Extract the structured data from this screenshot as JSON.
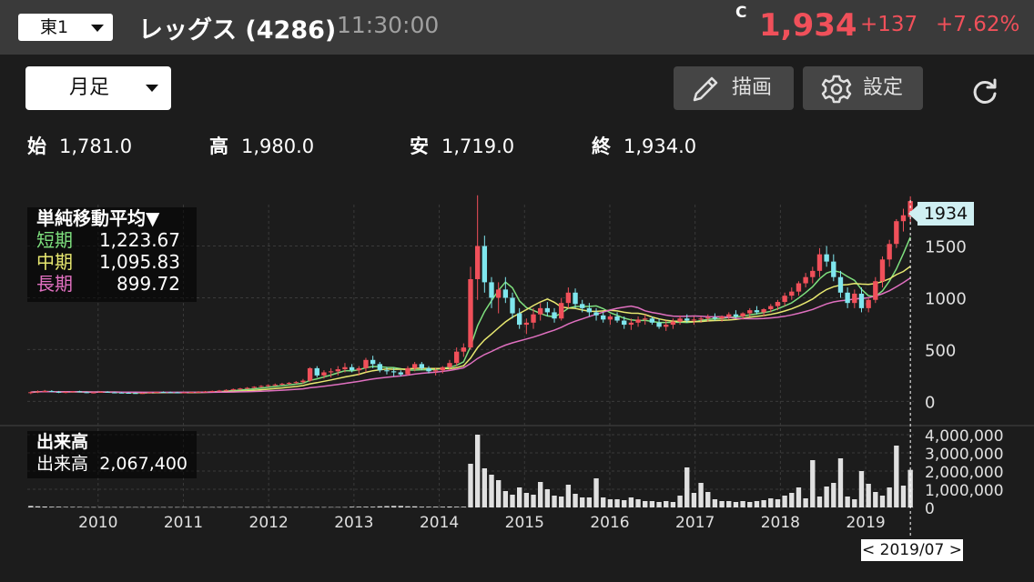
{
  "header": {
    "market": "東1",
    "title": "レッグス (4286)",
    "time": "11:30:00",
    "c_mark": "C",
    "price": "1,934",
    "change": "+137",
    "change_pct": "+7.62%",
    "up_color": "#f0505a"
  },
  "toolbar": {
    "period": "月足",
    "draw_label": "描画",
    "settings_label": "設定"
  },
  "ohlc": {
    "open_label": "始",
    "open": "1,781.0",
    "high_label": "高",
    "high": "1,980.0",
    "low_label": "安",
    "low": "1,719.0",
    "close_label": "終",
    "close": "1,934.0"
  },
  "ma_legend": {
    "title": "単純移動平均▼",
    "short_label": "短期",
    "short": "1,223.67",
    "short_color": "#7ee07e",
    "mid_label": "中期",
    "mid": "1,095.83",
    "mid_color": "#e8e870",
    "long_label": "長期",
    "long": "899.72",
    "long_color": "#e070c0"
  },
  "volume_legend": {
    "title": "出来高",
    "label": "出来高",
    "value": "2,067,400"
  },
  "price_tag": "1934",
  "date_tag": "< 2019/07 >",
  "chart_data": {
    "type": "candlestick",
    "interval": "monthly",
    "price_axis": {
      "ticks": [
        0,
        500,
        1000,
        1500
      ],
      "tick_labels": [
        "0",
        "500",
        "1000",
        "1500"
      ],
      "range": [
        -120,
        1900
      ]
    },
    "volume_axis": {
      "ticks": [
        0,
        1000000,
        2000000,
        3000000,
        4000000
      ],
      "tick_labels": [
        "0",
        "1,000,000",
        "2,000,000",
        "3,000,000",
        "4,000,000"
      ],
      "range": [
        0,
        4000000
      ]
    },
    "x_labels": [
      "2010",
      "2011",
      "2012",
      "2013",
      "2014",
      "2015",
      "2016",
      "2017",
      "2018",
      "2019"
    ],
    "x_start": 2009.17,
    "ohlc": [
      [
        80,
        95,
        70,
        88
      ],
      [
        88,
        105,
        80,
        95
      ],
      [
        95,
        110,
        88,
        100
      ],
      [
        100,
        108,
        88,
        92
      ],
      [
        92,
        100,
        80,
        85
      ],
      [
        85,
        95,
        78,
        90
      ],
      [
        90,
        100,
        85,
        96
      ],
      [
        96,
        102,
        86,
        88
      ],
      [
        88,
        94,
        80,
        82
      ],
      [
        82,
        90,
        76,
        86
      ],
      [
        86,
        95,
        82,
        92
      ],
      [
        92,
        98,
        84,
        86
      ],
      [
        86,
        92,
        80,
        84
      ],
      [
        84,
        90,
        78,
        82
      ],
      [
        82,
        88,
        76,
        80
      ],
      [
        80,
        86,
        74,
        78
      ],
      [
        78,
        84,
        72,
        80
      ],
      [
        80,
        90,
        76,
        86
      ],
      [
        86,
        94,
        80,
        90
      ],
      [
        90,
        96,
        84,
        88
      ],
      [
        88,
        94,
        82,
        86
      ],
      [
        86,
        92,
        80,
        84
      ],
      [
        84,
        90,
        78,
        86
      ],
      [
        86,
        92,
        82,
        90
      ],
      [
        90,
        98,
        84,
        92
      ],
      [
        92,
        100,
        86,
        96
      ],
      [
        96,
        104,
        90,
        100
      ],
      [
        100,
        110,
        94,
        104
      ],
      [
        104,
        116,
        98,
        110
      ],
      [
        110,
        124,
        104,
        118
      ],
      [
        118,
        130,
        110,
        124
      ],
      [
        124,
        138,
        116,
        130
      ],
      [
        130,
        146,
        122,
        140
      ],
      [
        140,
        156,
        132,
        148
      ],
      [
        148,
        164,
        138,
        156
      ],
      [
        156,
        172,
        146,
        162
      ],
      [
        162,
        178,
        154,
        170
      ],
      [
        170,
        186,
        160,
        178
      ],
      [
        178,
        196,
        168,
        186
      ],
      [
        186,
        216,
        170,
        200
      ],
      [
        200,
        330,
        190,
        320
      ],
      [
        320,
        340,
        230,
        250
      ],
      [
        250,
        300,
        220,
        280
      ],
      [
        280,
        320,
        230,
        290
      ],
      [
        290,
        340,
        250,
        310
      ],
      [
        310,
        370,
        280,
        330
      ],
      [
        330,
        360,
        280,
        300
      ],
      [
        300,
        340,
        250,
        320
      ],
      [
        320,
        420,
        280,
        400
      ],
      [
        400,
        440,
        320,
        360
      ],
      [
        360,
        380,
        280,
        300
      ],
      [
        300,
        330,
        260,
        290
      ],
      [
        290,
        320,
        240,
        280
      ],
      [
        280,
        300,
        240,
        260
      ],
      [
        260,
        340,
        250,
        320
      ],
      [
        320,
        380,
        290,
        360
      ],
      [
        360,
        380,
        300,
        320
      ],
      [
        320,
        340,
        270,
        290
      ],
      [
        290,
        320,
        250,
        300
      ],
      [
        300,
        340,
        270,
        330
      ],
      [
        330,
        400,
        300,
        370
      ],
      [
        370,
        520,
        340,
        480
      ],
      [
        480,
        560,
        430,
        520
      ],
      [
        520,
        1300,
        500,
        1180
      ],
      [
        1180,
        1990,
        980,
        1500
      ],
      [
        1500,
        1600,
        1050,
        1150
      ],
      [
        1150,
        1200,
        900,
        1000
      ],
      [
        1000,
        1150,
        850,
        1080
      ],
      [
        1080,
        1200,
        950,
        1000
      ],
      [
        1000,
        1050,
        800,
        850
      ],
      [
        850,
        900,
        700,
        740
      ],
      [
        740,
        800,
        650,
        760
      ],
      [
        760,
        900,
        700,
        840
      ],
      [
        840,
        950,
        780,
        900
      ],
      [
        900,
        960,
        820,
        860
      ],
      [
        860,
        900,
        760,
        800
      ],
      [
        800,
        1000,
        780,
        950
      ],
      [
        950,
        1100,
        900,
        1050
      ],
      [
        1050,
        1090,
        900,
        940
      ],
      [
        940,
        980,
        860,
        900
      ],
      [
        900,
        950,
        820,
        860
      ],
      [
        860,
        900,
        780,
        830
      ],
      [
        830,
        860,
        760,
        790
      ],
      [
        790,
        840,
        740,
        820
      ],
      [
        820,
        860,
        760,
        780
      ],
      [
        780,
        820,
        700,
        740
      ],
      [
        740,
        800,
        690,
        760
      ],
      [
        760,
        820,
        720,
        790
      ],
      [
        790,
        840,
        740,
        800
      ],
      [
        800,
        820,
        740,
        760
      ],
      [
        760,
        800,
        700,
        720
      ],
      [
        720,
        780,
        680,
        740
      ],
      [
        740,
        800,
        700,
        770
      ],
      [
        770,
        830,
        740,
        800
      ],
      [
        800,
        840,
        760,
        780
      ],
      [
        780,
        820,
        740,
        790
      ],
      [
        790,
        820,
        760,
        800
      ],
      [
        800,
        840,
        770,
        810
      ],
      [
        810,
        850,
        780,
        800
      ],
      [
        800,
        830,
        770,
        820
      ],
      [
        820,
        860,
        790,
        840
      ],
      [
        840,
        880,
        800,
        820
      ],
      [
        820,
        860,
        790,
        850
      ],
      [
        850,
        900,
        820,
        880
      ],
      [
        880,
        920,
        840,
        860
      ],
      [
        860,
        900,
        820,
        890
      ],
      [
        890,
        940,
        860,
        920
      ],
      [
        920,
        980,
        880,
        960
      ],
      [
        960,
        1050,
        920,
        1020
      ],
      [
        1020,
        1100,
        980,
        1060
      ],
      [
        1060,
        1160,
        1020,
        1140
      ],
      [
        1140,
        1240,
        1100,
        1200
      ],
      [
        1200,
        1300,
        1140,
        1260
      ],
      [
        1260,
        1480,
        1200,
        1420
      ],
      [
        1420,
        1500,
        1300,
        1350
      ],
      [
        1350,
        1420,
        1160,
        1200
      ],
      [
        1200,
        1260,
        1000,
        1050
      ],
      [
        1050,
        1100,
        900,
        950
      ],
      [
        950,
        1080,
        900,
        1040
      ],
      [
        1040,
        1100,
        860,
        900
      ],
      [
        900,
        1000,
        860,
        980
      ],
      [
        980,
        1200,
        950,
        1160
      ],
      [
        1160,
        1400,
        1100,
        1370
      ],
      [
        1370,
        1560,
        1300,
        1520
      ],
      [
        1520,
        1760,
        1480,
        1740
      ],
      [
        1740,
        1860,
        1640,
        1797
      ],
      [
        1781,
        1980,
        1719,
        1934
      ]
    ],
    "volume": [
      80000,
      60000,
      50000,
      40000,
      40000,
      30000,
      30000,
      30000,
      20000,
      20000,
      20000,
      20000,
      20000,
      20000,
      20000,
      20000,
      20000,
      20000,
      20000,
      20000,
      20000,
      20000,
      20000,
      20000,
      20000,
      20000,
      20000,
      20000,
      20000,
      20000,
      20000,
      20000,
      20000,
      20000,
      20000,
      20000,
      20000,
      20000,
      20000,
      20000,
      20000,
      20000,
      20000,
      20000,
      20000,
      20000,
      40000,
      40000,
      40000,
      40000,
      60000,
      70000,
      80000,
      80000,
      60000,
      60000,
      40000,
      40000,
      40000,
      40000,
      50000,
      40000,
      40000,
      2400000,
      4000000,
      2150000,
      1800000,
      1500000,
      900000,
      700000,
      1100000,
      800000,
      700000,
      1400000,
      1000000,
      650000,
      600000,
      1250000,
      750000,
      550000,
      550000,
      1600000,
      550000,
      450000,
      450000,
      400000,
      550000,
      450000,
      350000,
      350000,
      300000,
      350000,
      300000,
      650000,
      2200000,
      800000,
      1350000,
      850000,
      450000,
      350000,
      350000,
      300000,
      350000,
      300000,
      350000,
      400000,
      500000,
      450000,
      650000,
      800000,
      1100000,
      500000,
      2600000,
      600000,
      1150000,
      1350000,
      2700000,
      600000,
      450000,
      2000000,
      1300000,
      850000,
      650000,
      1100000,
      3400000,
      1200000,
      2067400
    ],
    "moving_averages": [
      {
        "name": "短期",
        "color": "#7ee07e",
        "last": 1223.67
      },
      {
        "name": "中期",
        "color": "#e8e870",
        "last": 1095.83
      },
      {
        "name": "長期",
        "color": "#e070c0",
        "last": 899.72
      }
    ],
    "last": {
      "label": "1934",
      "value": 1934,
      "date": "2019/07"
    }
  }
}
